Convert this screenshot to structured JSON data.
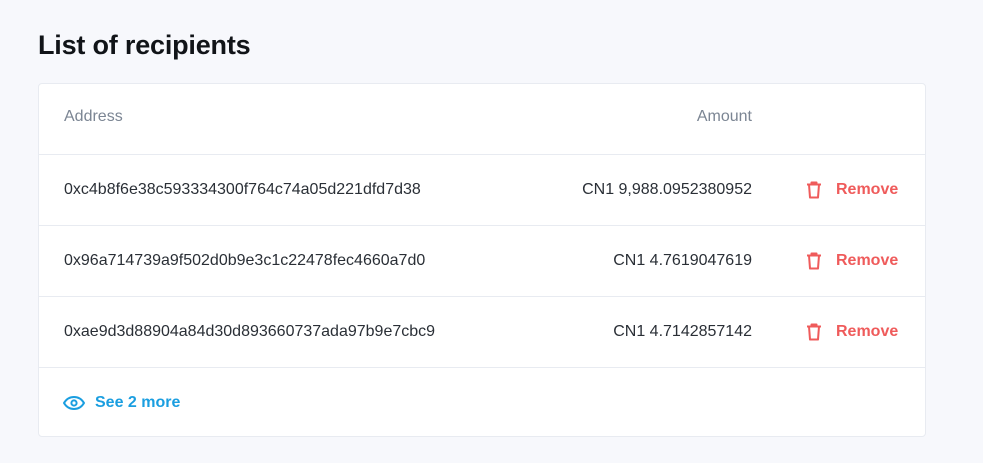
{
  "page": {
    "title": "List of recipients"
  },
  "table": {
    "headers": {
      "address": "Address",
      "amount": "Amount"
    },
    "rows": [
      {
        "address": "0xc4b8f6e38c593334300f764c74a05d221dfd7d38",
        "amount": "CN1 9,988.0952380952",
        "remove_label": "Remove"
      },
      {
        "address": "0x96a714739a9f502d0b9e3c1c22478fec4660a7d0",
        "amount": "CN1 4.7619047619",
        "remove_label": "Remove"
      },
      {
        "address": "0xae9d3d88904a84d30d893660737ada97b9e7cbc9",
        "amount": "CN1 4.7142857142",
        "remove_label": "Remove"
      }
    ],
    "see_more_label": "See 2 more"
  },
  "icons": {
    "remove": "trash-icon",
    "see_more": "eye-icon"
  },
  "colors": {
    "remove": "#ef5b5b",
    "link": "#1a9ee0",
    "header_text": "#7b8593",
    "body_text": "#2a2f36",
    "background": "#f7f8fc",
    "card": "#ffffff"
  }
}
